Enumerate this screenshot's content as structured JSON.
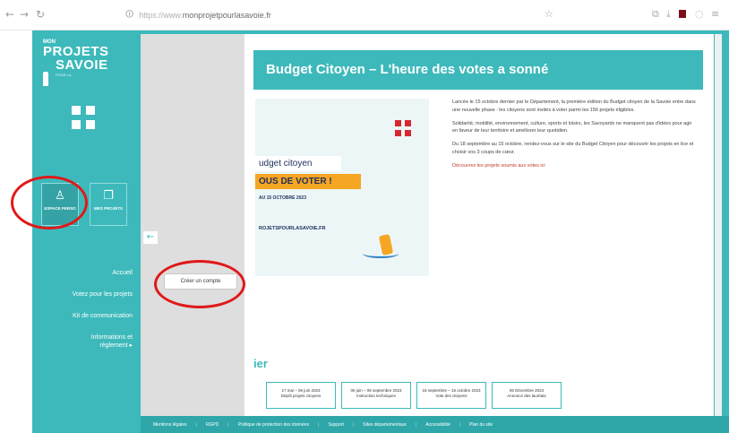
{
  "browser": {
    "url_prefix": "https://www.",
    "url_domain": "monprojetpourlasavoie.fr",
    "nav_icons": [
      "back-arrow",
      "forward-arrow",
      "reload"
    ],
    "toolbar_icons": [
      "star",
      "extensions",
      "downloads",
      "profile",
      "menu"
    ]
  },
  "sidebar": {
    "logo": {
      "line1": "MON",
      "line2": "PROJETS",
      "line3": "SAVOIE",
      "tagline": "POUR LA"
    },
    "buttons": [
      {
        "label": "ESPACE PERSO",
        "icon": "user-icon"
      },
      {
        "label": "MES PROJETS",
        "icon": "document-icon"
      }
    ],
    "menu": [
      "Accueil",
      "Votez pour les projets",
      "Kit de communication",
      "Informations et règlement ▸"
    ]
  },
  "panel": {
    "collapse_icon": "←",
    "create_account": "Créer un compte"
  },
  "main": {
    "title": "Budget Citoyen – L'heure des votes a sonné",
    "visual": {
      "line1": "udget citoyen",
      "line2": "OUS DE VOTER !",
      "line3": "AU 15 OCTOBRE 2023",
      "line4": "ROJETSPOURLASAVOIE.FR"
    },
    "paragraphs": [
      "Lancée le 15 octobre dernier par le Département, la première édition du Budget citoyen de la Savoie entre dans une nouvelle phase : les citoyens sont invités à voter parmi les 156 projets éligibles.",
      "Solidarité, mobilité, environnement, culture, sports et loisirs, les Savoyards ne manquent pas d'idées pour agir en faveur de leur territoire et améliorer leur quotidien.",
      "Du 18 septembre au 15 octobre, rendez-vous sur le site du Budget Citoyen pour découvrir les projets en lice et choisir vos 3 coups de cœur."
    ],
    "link": "Découvrez les projets soumis aux votes ici",
    "timeline_title": "ier",
    "timeline": [
      {
        "date": "17 mai – 06 juin 2023",
        "label": "Dépôt projets citoyens"
      },
      {
        "date": "06 juin – 08 septembre 2023",
        "label": "Instruction techniques"
      },
      {
        "date": "18 septembre – 15 octobre 2023",
        "label": "Vote des citoyens"
      },
      {
        "date": "06 Décembre 2023",
        "label": "Annonce des lauréats"
      }
    ]
  },
  "footer": {
    "links": [
      "Mentions légales",
      "RGPD",
      "Politique de protection des données",
      "Support",
      "Sites départementaux",
      "Accessibilité",
      "Plan du site"
    ]
  },
  "colors": {
    "brand": "#3db9bb",
    "panel": "#dedede",
    "annotation": "#e01919",
    "accent": "#f5a623"
  }
}
